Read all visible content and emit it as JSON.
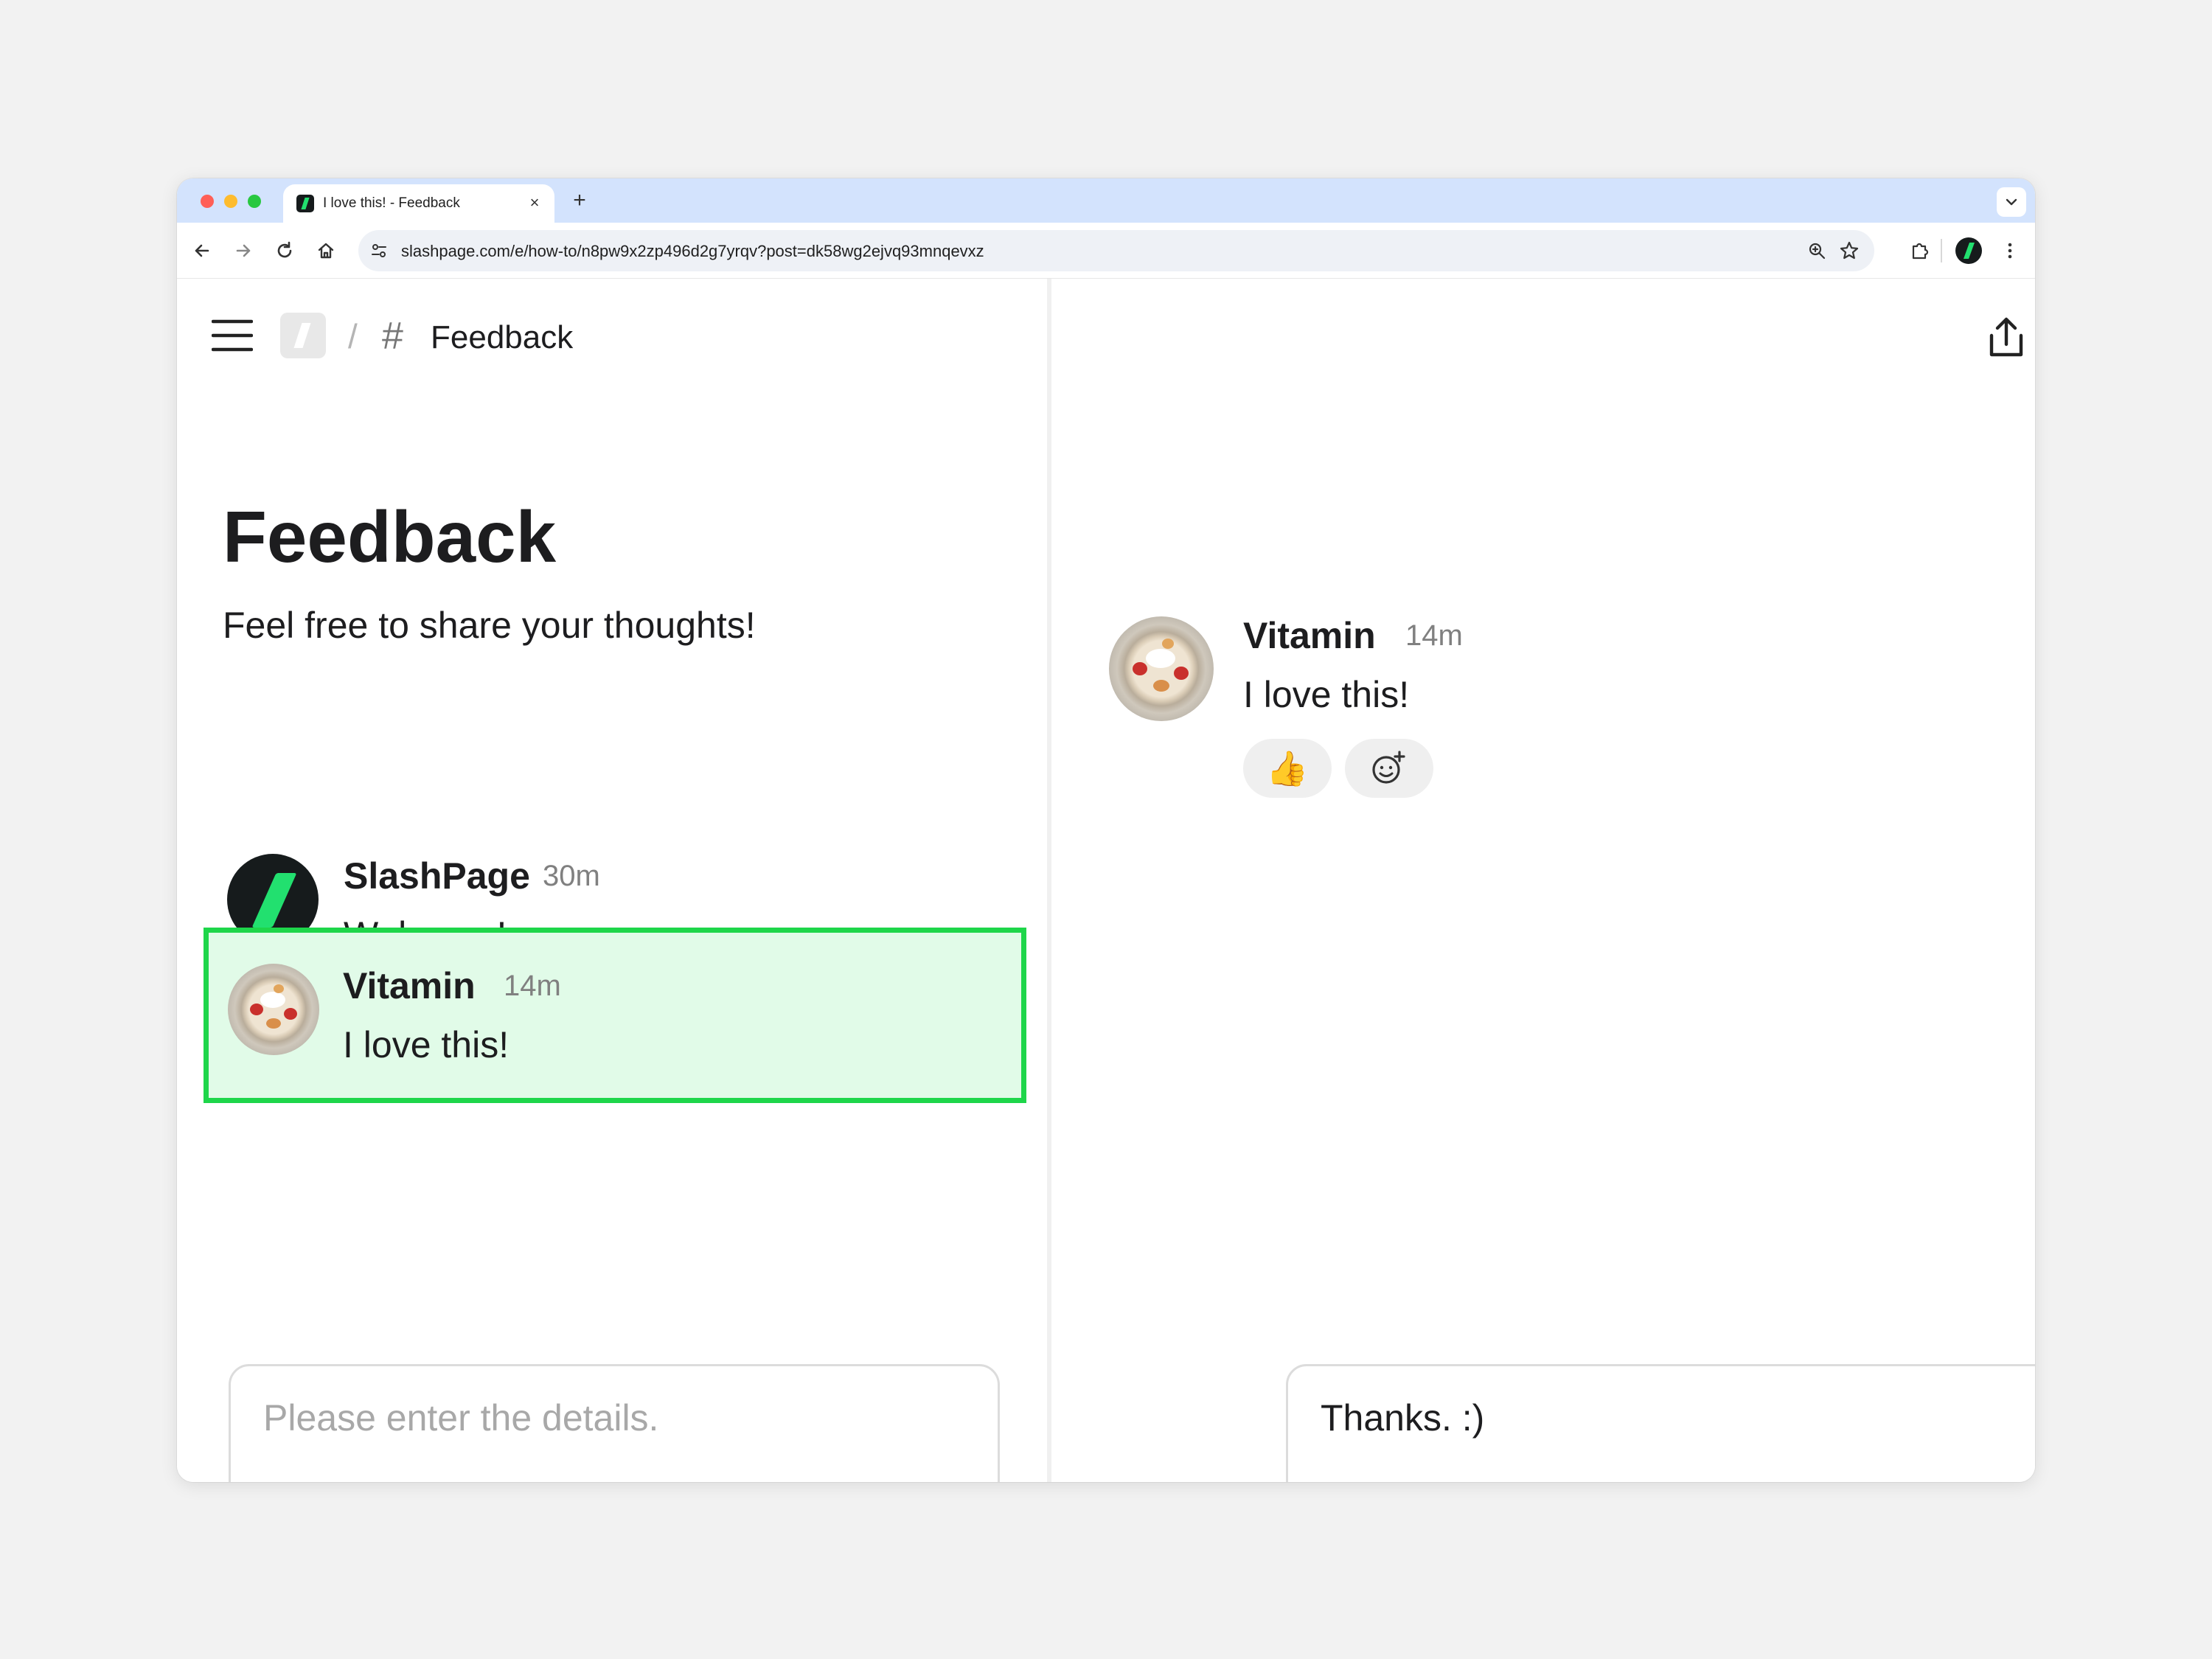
{
  "browser": {
    "tab_title": "I love this! - Feedback",
    "tab_close_glyph": "×",
    "new_tab_glyph": "+",
    "url": "slashpage.com/e/how-to/n8pw9x2zp496d2g7yrqv?post=dk58wg2ejvq93mnqevxz"
  },
  "breadcrumb": {
    "separator": "/",
    "hash": "#",
    "channel": "Feedback"
  },
  "page": {
    "title": "Feedback",
    "description": "Feel free to share your thoughts!"
  },
  "messages": [
    {
      "author": "SlashPage",
      "time": "30m",
      "body": "Welcome!"
    },
    {
      "author": "Vitamin",
      "time": "14m",
      "body": "I love this!"
    }
  ],
  "thread": {
    "author": "Vitamin",
    "time": "14m",
    "body": "I love this!",
    "reactions": [
      "👍"
    ]
  },
  "composer_left": {
    "placeholder": "Please enter the details."
  },
  "composer_right": {
    "value": "Thanks. :)"
  },
  "colors": {
    "brand_dark": "#161b1c",
    "brand_green": "#22e06f",
    "highlight": "#1ed64a",
    "send_active": "#0b2a1e"
  }
}
